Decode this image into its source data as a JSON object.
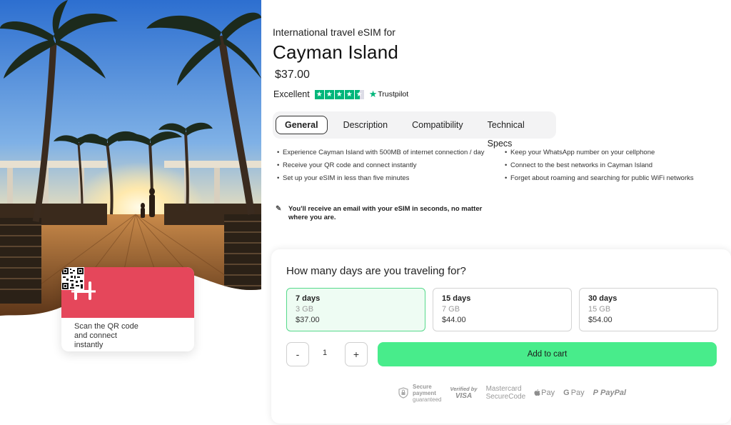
{
  "hero": {
    "card": {
      "logo_text": "H",
      "caption": "Scan the QR code and connect instantly"
    }
  },
  "product": {
    "subtitle": "International travel eSIM for",
    "title": "Cayman Island",
    "price": "$37.00",
    "rating_label": "Excellent",
    "stars": 4.5,
    "trustpilot_label": "Trustpilot"
  },
  "tabs": [
    "General",
    "Description",
    "Compatibility",
    "Technical Specs"
  ],
  "features_left": [
    "Experience Cayman Island with 500MB of internet connection / day",
    "Receive your QR code and connect instantly",
    "Set up your eSIM in less than five minutes"
  ],
  "features_right": [
    "Keep your WhatsApp number on your cellphone",
    "Connect to the best networks in Cayman Island",
    "Forget about roaming and searching for public WiFi networks"
  ],
  "email_note": "You'll receive an email with your eSIM in seconds, no matter where you are.",
  "purchase": {
    "question": "How many days are you traveling for?",
    "plans": [
      {
        "days": "7 days",
        "data": "3 GB",
        "price": "$37.00",
        "selected": true
      },
      {
        "days": "15 days",
        "data": "7 GB",
        "price": "$44.00",
        "selected": false
      },
      {
        "days": "30 days",
        "data": "15 GB",
        "price": "$54.00",
        "selected": false
      }
    ],
    "minus_label": "-",
    "quantity": "1",
    "plus_label": "+",
    "cart_label": "Add to cart"
  },
  "payments": {
    "secure_line1": "Secure",
    "secure_line2": "payment",
    "secure_line3": "guaranteed",
    "visa_line1": "Verified by",
    "visa_line2": "VISA",
    "mc_line1": "Mastercard",
    "mc_line2": "SecureCode",
    "apple_pay": "Pay",
    "google_pay": "Pay",
    "paypal": "PayPal"
  },
  "colors": {
    "brand": "#e5475b",
    "accent": "#48ec8b",
    "trustpilot": "#00b67a"
  }
}
